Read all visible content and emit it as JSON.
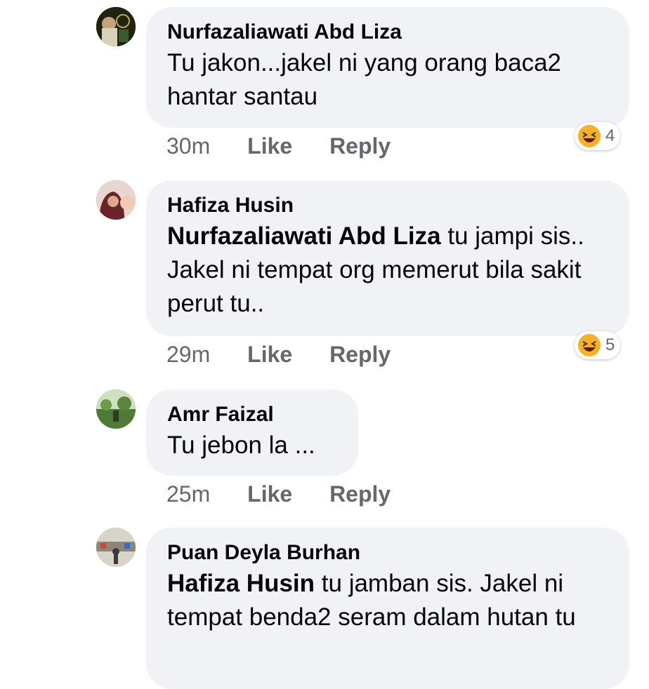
{
  "comments": [
    {
      "author": "Nurfazaliawati Abd Liza",
      "mention": "",
      "text": "Tu jakon...jakel ni yang orang baca2 hantar santau",
      "time": "30m",
      "like": "Like",
      "reply": "Reply",
      "reaction_icon": "haha-icon",
      "reaction_count": "4"
    },
    {
      "author": "Hafiza Husin",
      "mention": "Nurfazaliawati Abd Liza",
      "text": "tu jampi sis.. Jakel ni tempat org memerut bila sakit perut tu..",
      "time": "29m",
      "like": "Like",
      "reply": "Reply",
      "reaction_icon": "haha-icon",
      "reaction_count": "5"
    },
    {
      "author": "Amr Faizal",
      "mention": "",
      "text": "Tu jebon la ...",
      "time": "25m",
      "like": "Like",
      "reply": "Reply"
    },
    {
      "author": "Puan Deyla Burhan",
      "mention": "Hafiza Husin",
      "text": "tu jamban sis. Jakel ni tempat benda2 seram dalam hutan tu"
    }
  ],
  "colors": {
    "bubble": "#f0f2f5",
    "meta": "#65676b",
    "haha": "#f7b125"
  }
}
